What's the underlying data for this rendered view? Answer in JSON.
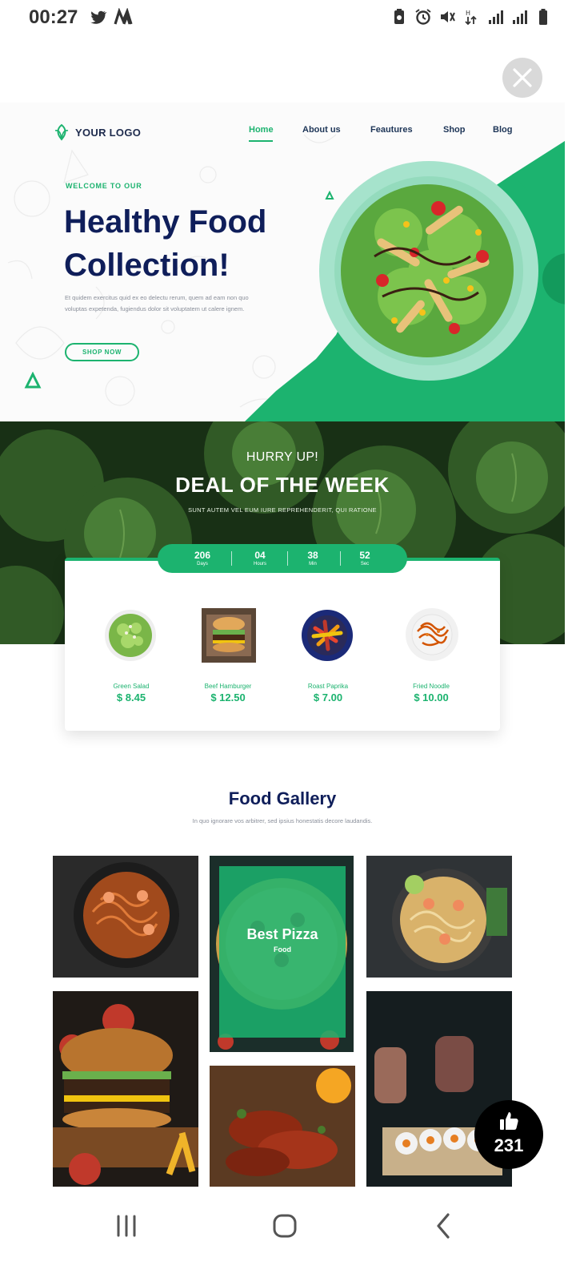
{
  "status_bar": {
    "time": "00:27",
    "icons": [
      "twitter-icon",
      "m-app-icon",
      "battery-saver-icon",
      "alarm-icon",
      "mute-icon",
      "data-icon",
      "signal-icon",
      "signal-icon",
      "battery-icon"
    ]
  },
  "hero": {
    "logo": "YOUR LOGO",
    "nav": [
      "Home",
      "About us",
      "Feautures",
      "Shop",
      "Blog"
    ],
    "welcome": "WELCOME TO OUR",
    "title_line1": "Healthy Food",
    "title_line2": "Collection!",
    "desc": "Et quidem exercitus quid ex eo delectu rerum, quem ad eam non quo voluptas expetenda, fugiendus dolor sit voluptatem ut calere ignem.",
    "cta": "SHOP NOW"
  },
  "deal": {
    "hurry": "HURRY UP!",
    "title": "DEAL OF THE WEEK",
    "subtitle": "SUNT AUTEM VEL EUM IURE REPREHENDERIT, QUI RATIONE",
    "countdown": [
      {
        "value": "206",
        "unit": "Days"
      },
      {
        "value": "04",
        "unit": "Hours"
      },
      {
        "value": "38",
        "unit": "Min"
      },
      {
        "value": "52",
        "unit": "Sec"
      }
    ],
    "items": [
      {
        "name": "Green Salad",
        "price": "$ 8.45"
      },
      {
        "name": "Beef Hamburger",
        "price": "$ 12.50"
      },
      {
        "name": "Roast Paprika",
        "price": "$ 7.00"
      },
      {
        "name": "Fried Noodle",
        "price": "$ 10.00"
      }
    ]
  },
  "gallery": {
    "title": "Food Gallery",
    "subtitle": "In quo ignorare vos arbitrer, sed ipsius honestatis decore laudandis.",
    "featured_title": "Best Pizza",
    "featured_category": "Food"
  },
  "like": {
    "count": "231"
  },
  "colors": {
    "accent": "#1cb36f",
    "navy": "#0f1e5a",
    "deal_bg": "#1f3e1c"
  }
}
